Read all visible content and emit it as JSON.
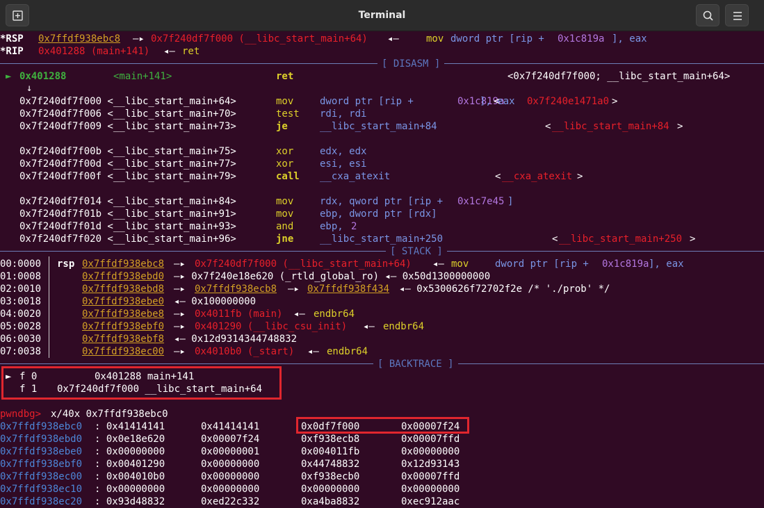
{
  "window": {
    "title": "Terminal"
  },
  "header": {
    "new_tab_icon": "new-tab-icon",
    "search_icon": "search-icon",
    "menu_icon": "hamburger-menu-icon"
  },
  "sections": {
    "disasm": "[ DISASM ]",
    "stack": "[ STACK ]",
    "backtrace": "[ BACKTRACE ]"
  },
  "colors": {
    "background": "#300a24",
    "red": "#e8202a",
    "yellow": "#ddd02a",
    "purple": "#b377e0",
    "blue": "#7a96e6",
    "highlight_box": "#e0262e"
  },
  "lines": [
    [
      [
        "w bold",
        "*RSP"
      ],
      [
        "gold",
        "0x7ffdf938ebc8"
      ],
      [
        "w",
        "—▸"
      ],
      [
        "r",
        "0x7f240df7f000 (__libc_start_main+64)"
      ],
      [
        "w",
        "◂—"
      ],
      [
        "y",
        "mov"
      ],
      [
        "b",
        "dword ptr [rip + "
      ],
      [
        "p",
        "0x1c819a"
      ],
      [
        "b",
        "], eax"
      ]
    ],
    [
      [
        "w bold",
        "*RIP"
      ],
      [
        "r",
        "0x401288 (main+141)"
      ],
      [
        "w",
        "◂—"
      ],
      [
        "y",
        "ret"
      ]
    ],
    [
      [
        "gb",
        "►"
      ],
      [
        "gb bold",
        "0x401288"
      ],
      [
        "gb",
        "<main+141>"
      ],
      [
        "y bold",
        "ret"
      ],
      [
        "w",
        "<0x7f240df7f000; __libc_start_main+64>"
      ]
    ],
    [
      [
        "w",
        "↓"
      ]
    ],
    [
      [
        "w",
        "0x7f240df7f000 <__libc_start_main+64>"
      ],
      [
        "y",
        "mov"
      ],
      [
        "b",
        "dword ptr [rip + "
      ],
      [
        "p",
        "0x1c819a"
      ],
      [
        "b",
        "], eax"
      ],
      [
        "w",
        "<"
      ],
      [
        "r",
        "0x7f240e1471a0"
      ],
      [
        "w",
        ">"
      ]
    ],
    [
      [
        "w",
        "0x7f240df7f006 <__libc_start_main+70>"
      ],
      [
        "y",
        "test"
      ],
      [
        "b",
        "rdi, rdi"
      ]
    ],
    [
      [
        "w",
        "0x7f240df7f009 <__libc_start_main+73>"
      ],
      [
        "y bold",
        "je"
      ],
      [
        "b",
        "__libc_start_main+84"
      ],
      [
        "w",
        "<"
      ],
      [
        "r",
        "__libc_start_main+84"
      ],
      [
        "w",
        ">"
      ]
    ],
    [
      [
        "w",
        "0x7f240df7f00b <__libc_start_main+75>"
      ],
      [
        "y",
        "xor"
      ],
      [
        "b",
        "edx, edx"
      ]
    ],
    [
      [
        "w",
        "0x7f240df7f00d <__libc_start_main+77>"
      ],
      [
        "y",
        "xor"
      ],
      [
        "b",
        "esi, esi"
      ]
    ],
    [
      [
        "w",
        "0x7f240df7f00f <__libc_start_main+79>"
      ],
      [
        "y bold",
        "call"
      ],
      [
        "b",
        "__cxa_atexit"
      ],
      [
        "w",
        "<"
      ],
      [
        "r",
        "__cxa_atexit"
      ],
      [
        "w",
        ">"
      ]
    ],
    [
      [
        "w",
        "0x7f240df7f014 <__libc_start_main+84>"
      ],
      [
        "y",
        "mov"
      ],
      [
        "b",
        "rdx, qword ptr [rip + "
      ],
      [
        "p",
        "0x1c7e45"
      ],
      [
        "b",
        "]"
      ]
    ],
    [
      [
        "w",
        "0x7f240df7f01b <__libc_start_main+91>"
      ],
      [
        "y",
        "mov"
      ],
      [
        "b",
        "ebp, dword ptr [rdx]"
      ]
    ],
    [
      [
        "w",
        "0x7f240df7f01d <__libc_start_main+93>"
      ],
      [
        "y",
        "and"
      ],
      [
        "b",
        "ebp, "
      ],
      [
        "p",
        "2"
      ]
    ],
    [
      [
        "w",
        "0x7f240df7f020 <__libc_start_main+96>"
      ],
      [
        "y bold",
        "jne"
      ],
      [
        "b",
        "__libc_start_main+250"
      ],
      [
        "w",
        "<"
      ],
      [
        "r",
        "__libc_start_main+250"
      ],
      [
        "w",
        ">"
      ]
    ],
    [
      [
        "w",
        "00:0000"
      ],
      [
        "w bold",
        "rsp"
      ],
      [
        "gold",
        "0x7ffdf938ebc8"
      ],
      [
        "w",
        "—▸"
      ],
      [
        "r",
        "0x7f240df7f000 (__libc_start_main+64)"
      ],
      [
        "w",
        "◂—"
      ],
      [
        "y",
        "mov"
      ],
      [
        "b",
        "dword ptr [rip + "
      ],
      [
        "p",
        "0x1c819a"
      ],
      [
        "b",
        "], eax"
      ]
    ],
    [
      [
        "w",
        "01:0008"
      ],
      [
        "gold",
        "0x7ffdf938ebd0"
      ],
      [
        "w",
        "—▸ 0x7f240e18e620 (_rtld_global_ro) ◂— 0x50d1300000000"
      ]
    ],
    [
      [
        "w",
        "02:0010"
      ],
      [
        "gold",
        "0x7ffdf938ebd8"
      ],
      [
        "w",
        "—▸"
      ],
      [
        "gold",
        "0x7ffdf938ecb8"
      ],
      [
        "w",
        "—▸"
      ],
      [
        "gold",
        "0x7ffdf938f434"
      ],
      [
        "w",
        "◂— 0x5300626f72702f2e /* './prob' */"
      ]
    ],
    [
      [
        "w",
        "03:0018"
      ],
      [
        "gold",
        "0x7ffdf938ebe0"
      ],
      [
        "w",
        "◂— 0x100000000"
      ]
    ],
    [
      [
        "w",
        "04:0020"
      ],
      [
        "gold",
        "0x7ffdf938ebe8"
      ],
      [
        "w",
        "—▸"
      ],
      [
        "r",
        "0x4011fb (main)"
      ],
      [
        "w",
        "◂—"
      ],
      [
        "y",
        "endbr64"
      ]
    ],
    [
      [
        "w",
        "05:0028"
      ],
      [
        "gold",
        "0x7ffdf938ebf0"
      ],
      [
        "w",
        "—▸"
      ],
      [
        "r",
        "0x401290 (__libc_csu_init)"
      ],
      [
        "w",
        "◂—"
      ],
      [
        "y",
        "endbr64"
      ]
    ],
    [
      [
        "w",
        "06:0030"
      ],
      [
        "gold",
        "0x7ffdf938ebf8"
      ],
      [
        "w",
        "◂— 0x12d9314344748832"
      ]
    ],
    [
      [
        "w",
        "07:0038"
      ],
      [
        "gold",
        "0x7ffdf938ec00"
      ],
      [
        "w",
        "—▸"
      ],
      [
        "r",
        "0x4010b0 (_start)"
      ],
      [
        "w",
        "◂—"
      ],
      [
        "y",
        "endbr64"
      ]
    ],
    [
      [
        "w",
        "►"
      ],
      [
        "w",
        "f 0"
      ],
      [
        "w",
        "0x401288 main+141"
      ]
    ],
    [
      [
        "w",
        "f 1"
      ],
      [
        "w",
        "0x7f240df7f000 __libc_start_main+64"
      ]
    ],
    [
      [
        "r",
        "pwndbg>"
      ],
      [
        "w",
        "x/40x 0x7ffdf938ebc0"
      ]
    ],
    [
      [
        "c",
        "0x7ffdf938ebc0"
      ],
      [
        "w",
        ": 0x41414141"
      ],
      [
        "w",
        "0x41414141"
      ],
      [
        "w",
        "0x0df7f000"
      ],
      [
        "w",
        "0x00007f24"
      ]
    ],
    [
      [
        "c",
        "0x7ffdf938ebd0"
      ],
      [
        "w",
        ": 0x0e18e620"
      ],
      [
        "w",
        "0x00007f24"
      ],
      [
        "w",
        "0xf938ecb8"
      ],
      [
        "w",
        "0x00007ffd"
      ]
    ],
    [
      [
        "c",
        "0x7ffdf938ebe0"
      ],
      [
        "w",
        ": 0x00000000"
      ],
      [
        "w",
        "0x00000001"
      ],
      [
        "w",
        "0x004011fb"
      ],
      [
        "w",
        "0x00000000"
      ]
    ],
    [
      [
        "c",
        "0x7ffdf938ebf0"
      ],
      [
        "w",
        ": 0x00401290"
      ],
      [
        "w",
        "0x00000000"
      ],
      [
        "w",
        "0x44748832"
      ],
      [
        "w",
        "0x12d93143"
      ]
    ],
    [
      [
        "c",
        "0x7ffdf938ec00"
      ],
      [
        "w",
        ": 0x004010b0"
      ],
      [
        "w",
        "0x00000000"
      ],
      [
        "w",
        "0xf938ecb0"
      ],
      [
        "w",
        "0x00007ffd"
      ]
    ],
    [
      [
        "c",
        "0x7ffdf938ec10"
      ],
      [
        "w",
        ": 0x00000000"
      ],
      [
        "w",
        "0x00000000"
      ],
      [
        "w",
        "0x00000000"
      ],
      [
        "w",
        "0x00000000"
      ]
    ],
    [
      [
        "c",
        "0x7ffdf938ec20"
      ],
      [
        "w",
        ": 0x93d48832"
      ],
      [
        "w",
        "0xed22c332"
      ],
      [
        "w",
        "0xa4ba8832"
      ],
      [
        "w",
        "0xec912aac"
      ]
    ]
  ]
}
